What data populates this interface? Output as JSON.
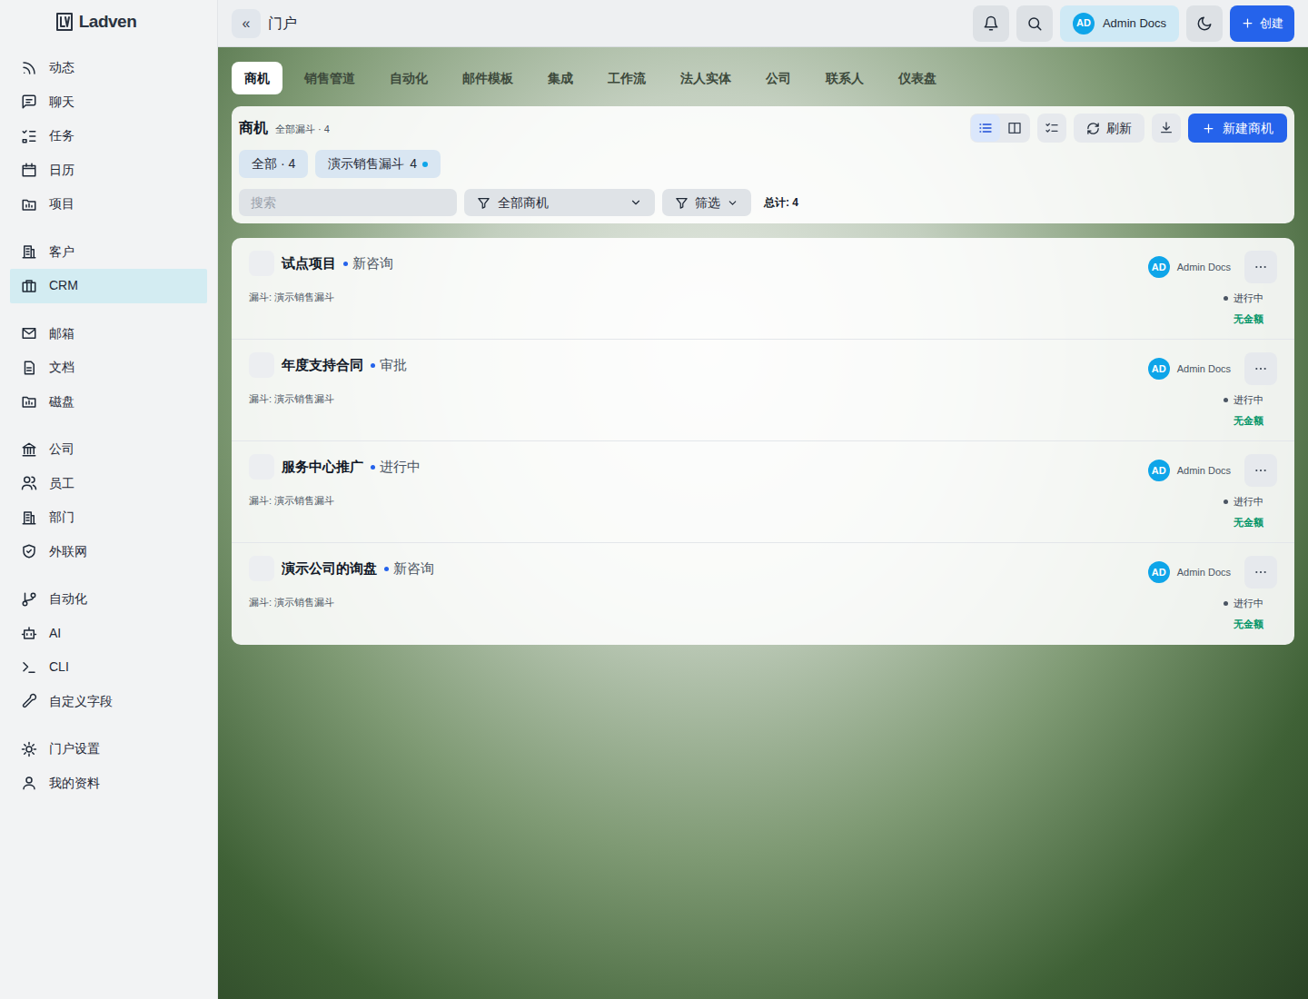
{
  "brand": {
    "name": "Ladven"
  },
  "sidebar": {
    "groups": [
      [
        {
          "label": "动态",
          "selected": false
        },
        {
          "label": "聊天",
          "selected": false
        },
        {
          "label": "任务",
          "selected": false
        },
        {
          "label": "日历",
          "selected": false
        },
        {
          "label": "项目",
          "selected": false
        }
      ],
      [
        {
          "label": "客户",
          "selected": false
        },
        {
          "label": "CRM",
          "selected": true
        }
      ],
      [
        {
          "label": "邮箱",
          "selected": false
        },
        {
          "label": "文档",
          "selected": false
        },
        {
          "label": "磁盘",
          "selected": false
        }
      ],
      [
        {
          "label": "公司",
          "selected": false
        },
        {
          "label": "员工",
          "selected": false
        },
        {
          "label": "部门",
          "selected": false
        },
        {
          "label": "外联网",
          "selected": false
        }
      ],
      [
        {
          "label": "自动化",
          "selected": false
        },
        {
          "label": "AI",
          "selected": false
        },
        {
          "label": "CLI",
          "selected": false
        },
        {
          "label": "自定义字段",
          "selected": false
        }
      ],
      [
        {
          "label": "门户设置",
          "selected": false
        },
        {
          "label": "我的资料",
          "selected": false
        }
      ]
    ]
  },
  "topbar": {
    "collapse": "«",
    "title": "门户",
    "user": {
      "initials": "AD",
      "name": "Admin Docs"
    },
    "create": "创建"
  },
  "tabs": [
    {
      "label": "商机",
      "selected": true
    },
    {
      "label": "销售管道",
      "selected": false
    },
    {
      "label": "自动化",
      "selected": false
    },
    {
      "label": "邮件模板",
      "selected": false
    },
    {
      "label": "集成",
      "selected": false
    },
    {
      "label": "工作流",
      "selected": false
    },
    {
      "label": "法人实体",
      "selected": false
    },
    {
      "label": "公司",
      "selected": false
    },
    {
      "label": "联系人",
      "selected": false
    },
    {
      "label": "仪表盘",
      "selected": false
    }
  ],
  "panel": {
    "title": "商机",
    "subtitle": "全部漏斗 · 4",
    "views": [
      {
        "kind": "list",
        "selected": true
      },
      {
        "kind": "board",
        "selected": false
      }
    ],
    "refresh": "刷新",
    "new": "新建商机",
    "pipelines": [
      {
        "label": "全部 · 4",
        "count": "",
        "selected": false
      },
      {
        "label": "演示销售漏斗",
        "count": "4",
        "selected": true
      }
    ],
    "search": {
      "placeholder": "搜索"
    },
    "scope": "全部商机",
    "filter": "筛选",
    "total": "总计: 4"
  },
  "deals": [
    {
      "title": "试点项目",
      "stage": "新咨询",
      "pipeline": "漏斗: 演示销售漏斗",
      "owner": {
        "initials": "AD",
        "name": "Admin Docs"
      },
      "status": "进行中",
      "amount": "无金额",
      "checked": false
    },
    {
      "title": "年度支持合同",
      "stage": "审批",
      "pipeline": "漏斗: 演示销售漏斗",
      "owner": {
        "initials": "AD",
        "name": "Admin Docs"
      },
      "status": "进行中",
      "amount": "无金额",
      "checked": false
    },
    {
      "title": "服务中心推广",
      "stage": "进行中",
      "pipeline": "漏斗: 演示销售漏斗",
      "owner": {
        "initials": "AD",
        "name": "Admin Docs"
      },
      "status": "进行中",
      "amount": "无金额",
      "checked": false
    },
    {
      "title": "演示公司的询盘",
      "stage": "新咨询",
      "pipeline": "漏斗: 演示销售漏斗",
      "owner": {
        "initials": "AD",
        "name": "Admin Docs"
      },
      "status": "进行中",
      "amount": "无金额",
      "checked": false
    }
  ]
}
